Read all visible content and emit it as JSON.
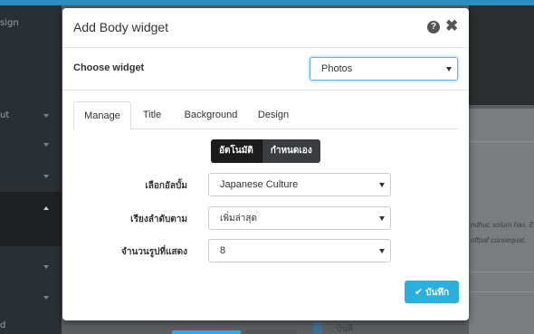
{
  "background": {
    "sidebar_items": [
      "sign",
      "ut",
      "d"
    ],
    "panel_text_1": "ndhuc solum has. E",
    "panel_text_2": "offpaf consequat.",
    "bottom_text": "บันทึ"
  },
  "modal": {
    "title": "Add Body widget",
    "help_icon": "question-circle",
    "close_icon": "times",
    "help_glyph": "?",
    "close_glyph": "✖"
  },
  "choose": {
    "label": "Choose widget",
    "value": "Photos"
  },
  "tabs": [
    {
      "label": "Manage",
      "active": true
    },
    {
      "label": "Title",
      "active": false
    },
    {
      "label": "Background",
      "active": false
    },
    {
      "label": "Design",
      "active": false
    }
  ],
  "mode_toggle": {
    "auto_label": "อัตโนมัติ",
    "custom_label": "กำหนดเอง",
    "selected": "อัตโนมัติ"
  },
  "form": {
    "album_label": "เลือกอัลบั้ม",
    "album_value": "Japanese Culture",
    "sort_label": "เรียงลำดับตาม",
    "sort_value": "เพิ่มล่าสุด",
    "count_label": "จำนวนรูปที่แสดง",
    "count_value": "8"
  },
  "save": {
    "label": "บันทึก",
    "icon": "check",
    "icon_glyph": "✔"
  },
  "colors": {
    "accent": "#2bb0de",
    "focus": "#66afe9",
    "toggle_active": "#1c1c1c"
  }
}
